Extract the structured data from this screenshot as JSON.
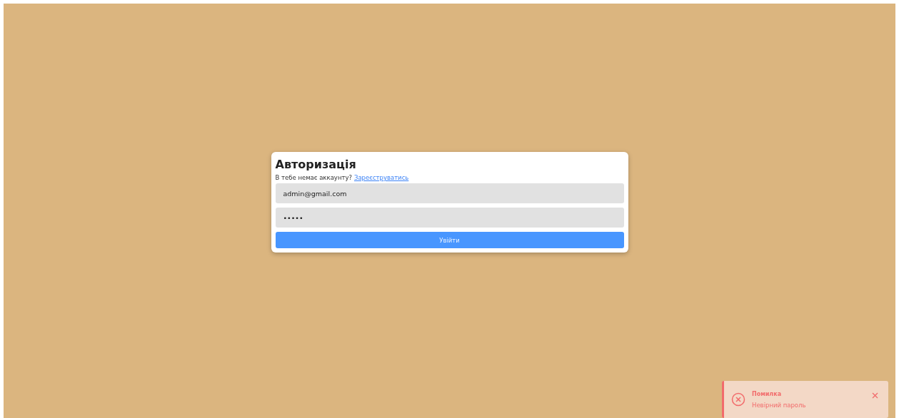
{
  "login_form": {
    "title": "Авторизація",
    "prompt": "В тебе немає аккаунту?",
    "register_link": "Зареєструватись",
    "email": {
      "value": "admin@gmail.com"
    },
    "password": {
      "value": "•••••"
    },
    "submit": "Увійти"
  },
  "toast": {
    "kind": "error",
    "title": "Помилка",
    "message": "Невірний пароль"
  }
}
